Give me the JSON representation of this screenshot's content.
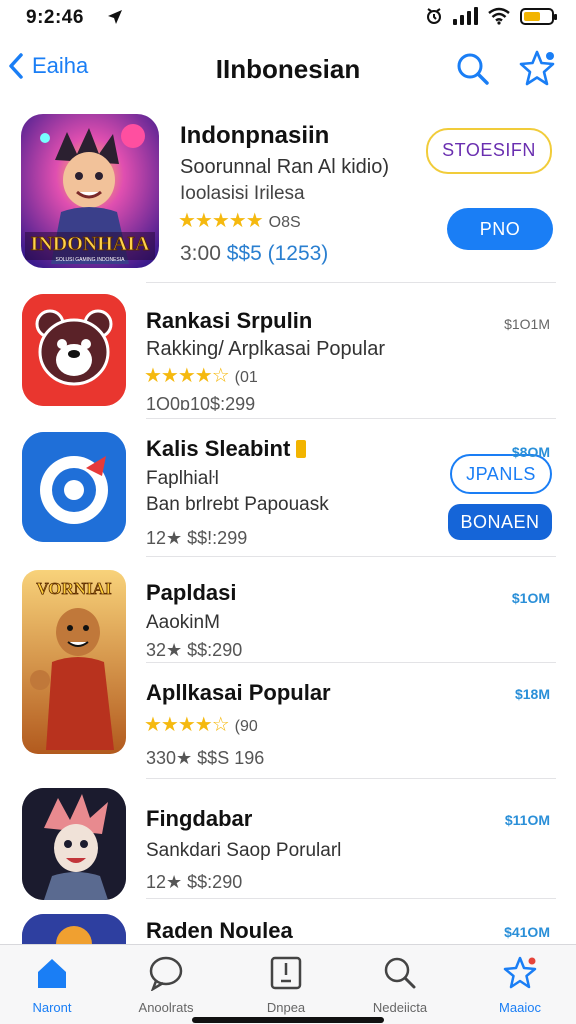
{
  "status": {
    "time": "9:2:46",
    "battery_color": "#f2b400"
  },
  "nav": {
    "back_label": "Eaiha",
    "title": "IInbonesian"
  },
  "apps": [
    {
      "name": "Indonpnasiin",
      "subtitle": "Soorunnal Ran Al kidio)",
      "category": "Ioolasisi Irilesa",
      "rating_stars": 5,
      "rating_count": "O8S",
      "meta": "3:00 ",
      "meta_price": "$$5 (1253)",
      "art_text": "INDONHAIA",
      "art_subtext": "SOLUSI GAMING INDONESIA",
      "buttons": [
        "STOESIFN",
        "PNO"
      ]
    },
    {
      "name": "Rankasi Srpulin",
      "subtitle": "Rakking/ Arplkasai Popular",
      "rating_stars": 4,
      "rating_count": "(01",
      "meta": "1O0ɒ10$:299",
      "price": "$1O1M",
      "button": "JPANLS"
    },
    {
      "name": "Kalis Sleabint",
      "subtitle": "Faplhiaŀl",
      "category": "Ban brlrebt Papouask",
      "meta": "12★ $$!:299",
      "price": "$8OM",
      "button": "BONAEN"
    },
    {
      "name": "Papldasi",
      "subtitle": "AaokinM",
      "meta": "32★ $$:290",
      "price": "$1OM",
      "art_text": "VORNIAI"
    },
    {
      "name": "Apllkasai Popular",
      "rating_stars": 4,
      "rating_count": "(90",
      "meta": "330★ $$S 196",
      "price": "$18M"
    },
    {
      "name": "Fingdabar",
      "subtitle": "Sankdari Saop Porularl",
      "meta": "12★ $$:290",
      "price": "$11OM"
    },
    {
      "name": "Raden Noulea",
      "price": "$41OM"
    }
  ],
  "tabs": [
    {
      "label": "Naront",
      "icon": "home-icon"
    },
    {
      "label": "Anoolrats",
      "icon": "chat-bubble-icon"
    },
    {
      "label": "Dnpea",
      "icon": "apps-box-icon"
    },
    {
      "label": "Nedeiicta",
      "icon": "search-icon"
    },
    {
      "label": "Maaioc",
      "icon": "star-icon"
    }
  ],
  "accent": "#1a7ef5"
}
